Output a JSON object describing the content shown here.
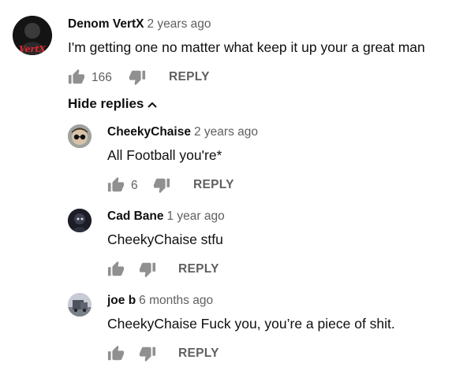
{
  "icons": {
    "like": "thumbs-up-icon",
    "dislike": "thumbs-down-icon",
    "collapse": "chevron-up-icon"
  },
  "colors": {
    "text": "#0f0f0f",
    "secondary": "#606060",
    "icon": "#909090"
  },
  "top_comment": {
    "author": "Denom VertX",
    "time": "2 years ago",
    "text": "I'm getting one no matter what keep it up your a great man",
    "likes": "166",
    "reply_label": "REPLY",
    "avatar_text": "VertX"
  },
  "replies_toggle": {
    "label": "Hide replies"
  },
  "replies": [
    {
      "author": "CheekyChaise",
      "time": "2 years ago",
      "text": "All Football you're*",
      "likes": "6",
      "reply_label": "REPLY"
    },
    {
      "author": "Cad Bane",
      "time": "1 year ago",
      "text": "CheekyChaise stfu",
      "likes": "",
      "reply_label": "REPLY"
    },
    {
      "author": "joe b",
      "time": "6 months ago",
      "text": "CheekyChaise Fuck you, you’re a piece of shit.",
      "likes": "",
      "reply_label": "REPLY"
    }
  ]
}
